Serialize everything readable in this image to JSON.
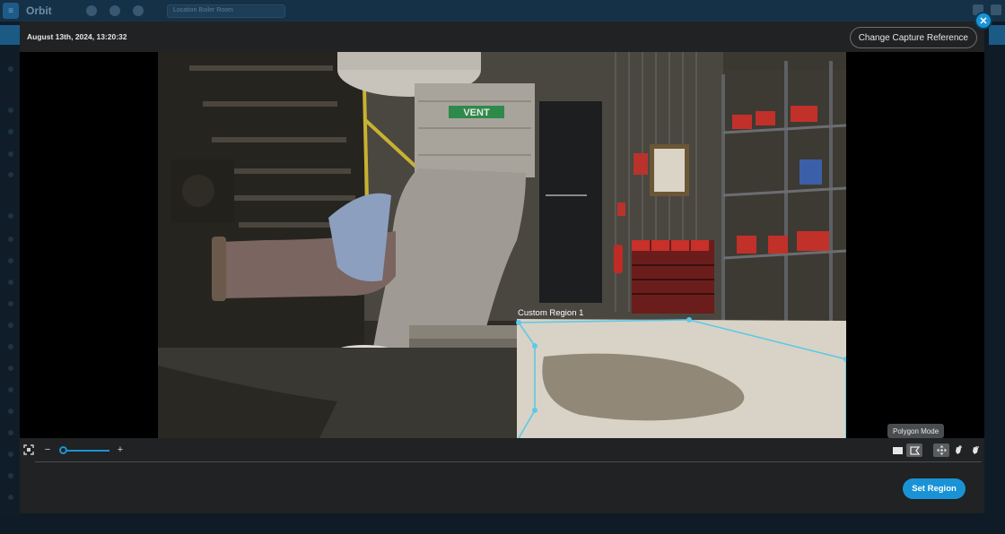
{
  "background_app": {
    "brand": "Orbit",
    "location_select": "Location Boiler Room"
  },
  "modal": {
    "timestamp": "August 13th, 2024, 13:20:32",
    "change_capture_button": "Change Capture Reference",
    "close_icon": "close-icon",
    "vent_label": "VENT",
    "region_label": "Custom Region 1",
    "tooltip": "Polygon Mode",
    "set_region_button": "Set Region",
    "zoom": {
      "minus": "−",
      "plus": "+",
      "level": 0
    },
    "tools": [
      "fit-screen-icon",
      "rectangle-mode-icon",
      "polygon-mode-icon",
      "move-icon",
      "add-point-icon",
      "remove-point-icon"
    ],
    "colors": {
      "accent": "#1a93d6",
      "region_outline": "#5fc8e8",
      "modal_bg": "#202223"
    }
  }
}
